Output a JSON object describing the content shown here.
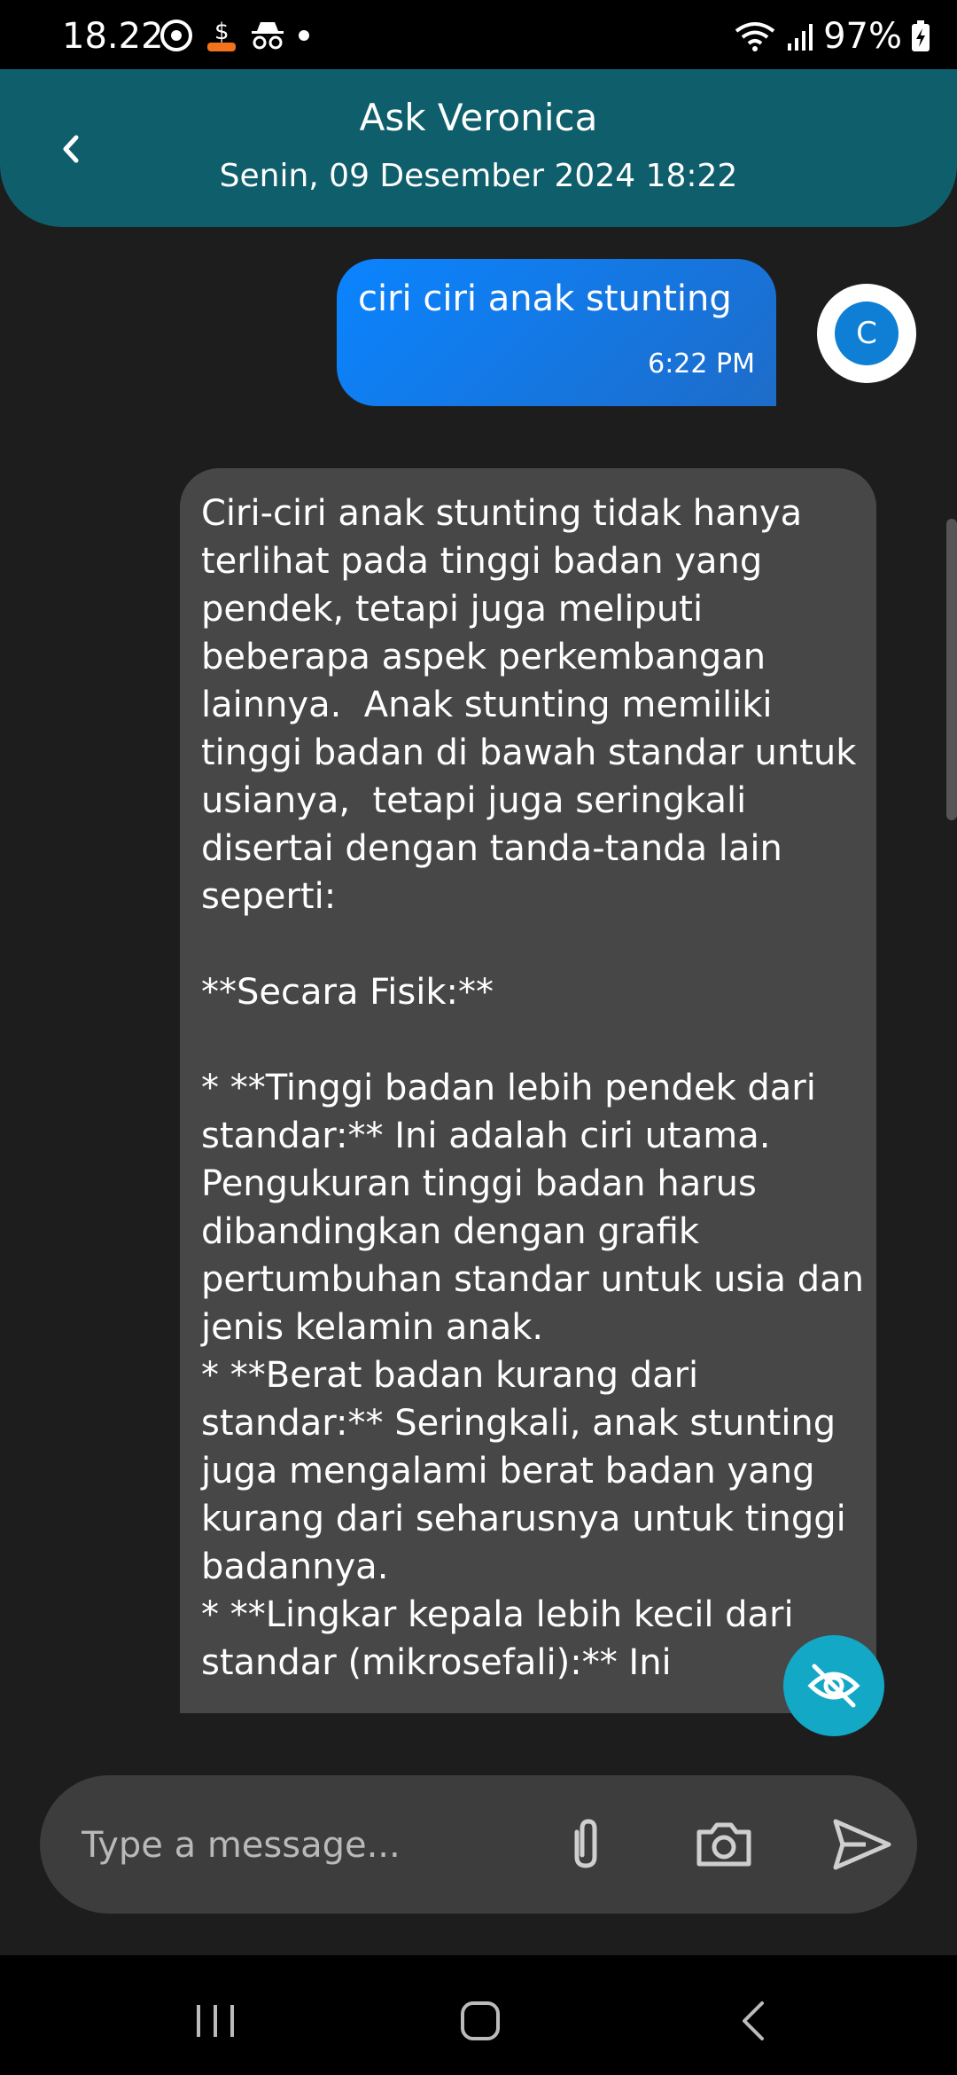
{
  "status_bar": {
    "time": "18.22",
    "battery": "97%",
    "icons": [
      "target-icon",
      "dollar-badge-icon",
      "incognito-icon",
      "dot-icon",
      "wifi-icon",
      "signal-icon",
      "battery-charging-icon"
    ]
  },
  "header": {
    "title": "Ask Veronica",
    "subtitle": "Senin, 09 Desember 2024 18:22",
    "back_icon": "chevron-left-icon"
  },
  "messages": [
    {
      "sender": "user",
      "text": "ciri ciri anak stunting",
      "time": "6:22 PM",
      "avatar_initial": "C"
    },
    {
      "sender": "bot",
      "text": "Ciri-ciri anak stunting tidak hanya terlihat pada tinggi badan yang pendek, tetapi juga meliputi beberapa aspek perkembangan lainnya.  Anak stunting memiliki tinggi badan di bawah standar untuk usianya,  tetapi juga seringkali disertai dengan tanda-tanda lain seperti:\n\n**Secara Fisik:**\n\n* **Tinggi badan lebih pendek dari standar:** Ini adalah ciri utama.  Pengukuran tinggi badan harus dibandingkan dengan grafik pertumbuhan standar untuk usia dan jenis kelamin anak.\n* **Berat badan kurang dari standar:** Seringkali, anak stunting juga mengalami berat badan yang kurang dari seharusnya untuk tinggi badannya.\n* **Lingkar kepala lebih kecil dari standar (mikrosefali):** Ini"
    }
  ],
  "composer": {
    "placeholder": "Type a message..."
  },
  "colors": {
    "background": "#1d1d1d",
    "header": "#0f5e6b",
    "user_bubble": "#0a84ff",
    "bot_bubble": "#474747",
    "fab": "#13a8c6",
    "composer": "#3d3d3d"
  }
}
